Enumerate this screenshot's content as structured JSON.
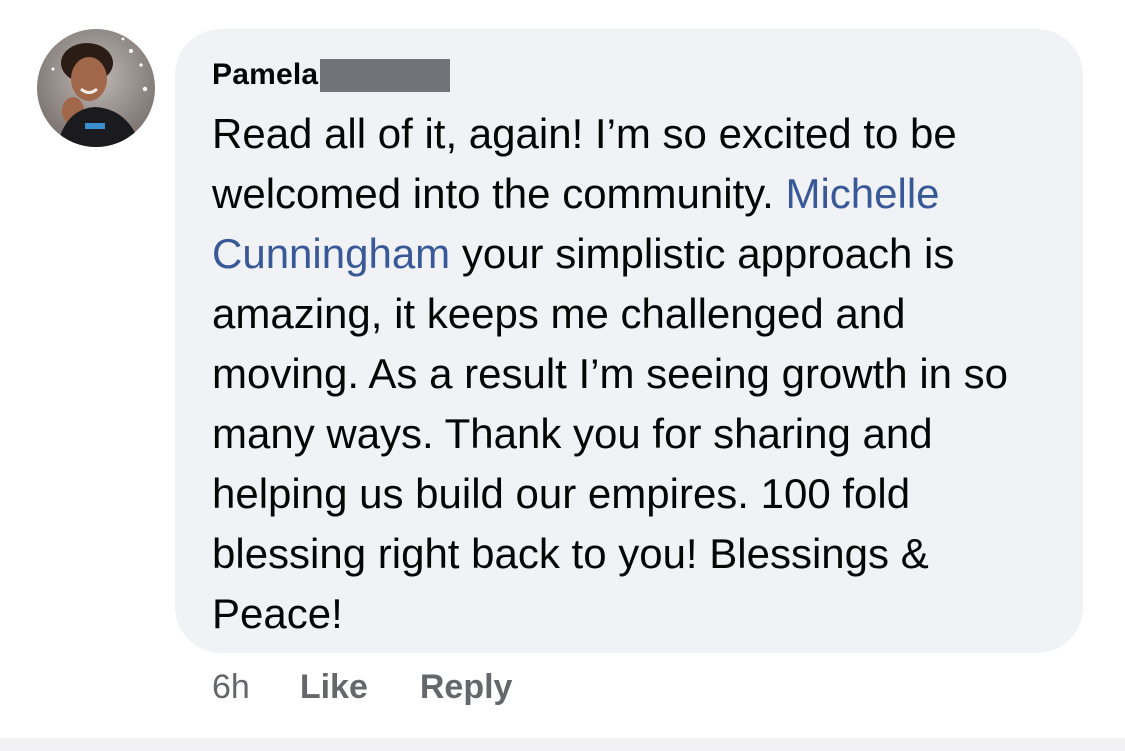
{
  "comment": {
    "author_name": "Pamela",
    "text_part1": "Read all of it, again! I’m so excited to be welcomed into the community. ",
    "mention": "Michelle Cunningham",
    "text_part2": " your simplistic approach is amazing, it keeps me challenged and moving. As a result I’m seeing growth in so many ways. Thank you for sharing and helping us build our empires.  100 fold blessing right back to you! Blessings & Peace!"
  },
  "meta": {
    "timestamp": "6h",
    "like_label": "Like",
    "reply_label": "Reply"
  },
  "colors": {
    "bubble": "#f0f2f5",
    "mention": "#385898",
    "meta": "#65676b",
    "text": "#050505",
    "redaction": "#71737a"
  },
  "icons": {
    "avatar": "profile-photo"
  }
}
